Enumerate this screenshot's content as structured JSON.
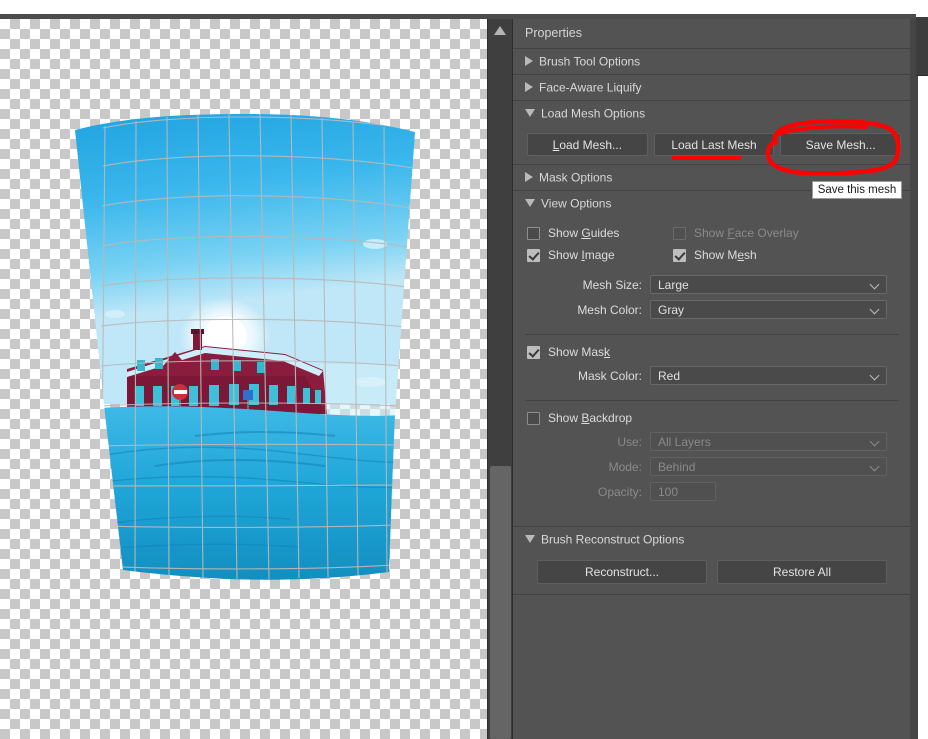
{
  "app": {
    "panel_title": "Properties"
  },
  "sections": {
    "brush_tool_options": {
      "label": "Brush Tool Options",
      "state": "collapsed"
    },
    "face_aware_liquify": {
      "label": "Face-Aware Liquify",
      "state": "collapsed"
    },
    "load_mesh_options": {
      "label": "Load Mesh Options",
      "state": "expanded"
    },
    "mask_options": {
      "label": "Mask Options",
      "state": "collapsed"
    },
    "view_options": {
      "label": "View Options",
      "state": "expanded"
    },
    "brush_reconstruct": {
      "label": "Brush Reconstruct Options",
      "state": "expanded"
    }
  },
  "load_mesh": {
    "load_mesh_button": "Load Mesh...",
    "load_last_mesh_button": "Load Last Mesh",
    "save_mesh_button": "Save Mesh..."
  },
  "tooltip": {
    "text": "Save this mesh"
  },
  "view_options": {
    "show_guides": {
      "label": "Show Guides",
      "checked": false,
      "enabled": true
    },
    "show_face_overlay": {
      "label": "Show Face Overlay",
      "checked": false,
      "enabled": false
    },
    "show_image": {
      "label": "Show Image",
      "checked": true,
      "enabled": true
    },
    "show_mesh": {
      "label": "Show Mesh",
      "checked": true,
      "enabled": true
    },
    "mesh_size": {
      "label": "Mesh Size:",
      "value": "Large",
      "enabled": true
    },
    "mesh_color": {
      "label": "Mesh Color:",
      "value": "Gray",
      "enabled": true
    },
    "show_mask": {
      "label": "Show Mask",
      "checked": true,
      "enabled": true
    },
    "mask_color": {
      "label": "Mask Color:",
      "value": "Red",
      "enabled": true
    },
    "show_backdrop": {
      "label": "Show Backdrop",
      "checked": false,
      "enabled": true
    },
    "use": {
      "label": "Use:",
      "value": "All Layers",
      "enabled": false
    },
    "mode": {
      "label": "Mode:",
      "value": "Behind",
      "enabled": false
    },
    "opacity": {
      "label": "Opacity:",
      "value": "100",
      "enabled": false,
      "slider_percent": 100
    }
  },
  "brush_reconstruct": {
    "reconstruct_button": "Reconstruct...",
    "restore_all_button": "Restore All"
  },
  "canvas": {
    "zoom_arrow_icon": "scroll-up-arrow",
    "artwork_description": "Liquify-distorted photo of a dark red brick building on a snowy street under a blue sky, overlaid with a warped gray mesh grid, on a transparency checkerboard"
  },
  "annotations": {
    "save_mesh_ellipse_color": "#ff0000",
    "load_last_mesh_underline_color": "#ff0000"
  },
  "colors": {
    "panel_background": "#535353",
    "panel_divider": "#434343",
    "button_face": "#454545",
    "text_primary": "#dcdcdc",
    "text_disabled": "#8a8a8a",
    "accent_red": "#ff0000",
    "checkbox_checked": "#bdbdbd"
  }
}
